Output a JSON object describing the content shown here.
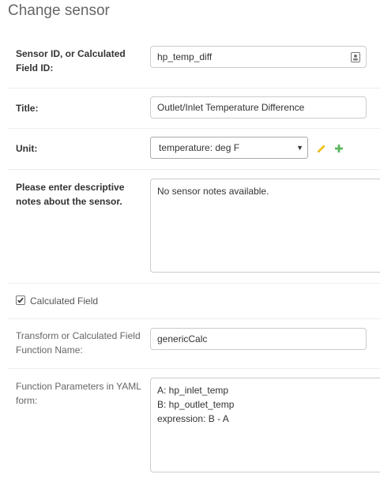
{
  "page": {
    "title": "Change sensor"
  },
  "sensor_id": {
    "label": "Sensor ID, or Calculated Field ID:",
    "value": "hp_temp_diff",
    "icon": "contact-card-icon"
  },
  "title_field": {
    "label": "Title:",
    "value": "Outlet/Inlet Temperature Difference"
  },
  "unit": {
    "label": "Unit:",
    "selected": "temperature: deg F",
    "edit_icon": "pencil-icon",
    "add_icon": "plus-icon",
    "edit_color": "#f0c419",
    "add_color": "#5cb85c"
  },
  "notes": {
    "label": "Please enter descriptive notes about the sensor.",
    "value": "No sensor notes available."
  },
  "calculated": {
    "label": "Calculated Field",
    "checked": true
  },
  "transform": {
    "label": "Transform or Calculated Field Function Name:",
    "value": "genericCalc"
  },
  "params": {
    "label": "Function Parameters in YAML form:",
    "value": "A: hp_inlet_temp\nB: hp_outlet_temp\nexpression: B - A"
  }
}
